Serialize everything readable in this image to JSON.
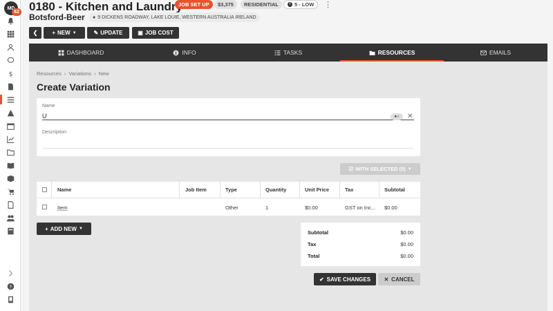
{
  "sidebar": {
    "avatar_initials": "MD",
    "notification_count": "82",
    "icons": [
      "bell-icon",
      "grid-icon",
      "user-icon",
      "chat-icon",
      "dollar-icon",
      "document-icon",
      "list-icon",
      "warning-icon",
      "calendar-icon",
      "chart-icon",
      "folder-icon",
      "book-icon",
      "box-icon",
      "cart-icon",
      "file-icon",
      "users-icon",
      "ledger-icon"
    ],
    "bottom_icons": [
      "chevron-right-icon",
      "help-icon",
      "tablet-icon"
    ]
  },
  "header": {
    "job_title": "0180 - Kitchen and Laundry",
    "status_badge": "JOB SET UP",
    "amount_badge": "$3,375",
    "type_badge": "RESIDENTIAL",
    "priority_badge": "5 - LOW",
    "client_name": "Botsford-Beer",
    "address": "9 DICKENS ROADWAY, LAKE LOUIE, WESTERN AUSTRALIA IRELAND"
  },
  "toolbar": {
    "new_label": "NEW",
    "update_label": "UPDATE",
    "job_cost_label": "JOB COST"
  },
  "tabs": [
    {
      "label": "DASHBOARD",
      "icon": "grid-icon"
    },
    {
      "label": "INFO",
      "icon": "info-icon"
    },
    {
      "label": "TASKS",
      "icon": "tasks-icon"
    },
    {
      "label": "RESOURCES",
      "icon": "folder-icon",
      "active": true
    },
    {
      "label": "EMAILS",
      "icon": "mail-icon"
    }
  ],
  "breadcrumb": [
    "Resources",
    "Variations",
    "New"
  ],
  "page_title": "Create Variation",
  "form": {
    "name_label": "Name",
    "name_value": "U",
    "description_label": "Description"
  },
  "with_selected_label": "WITH SELECTED (0)",
  "table": {
    "columns": [
      "Name",
      "Job Item",
      "Type",
      "Quantity",
      "Unit Price",
      "Tax",
      "Subtotal"
    ],
    "rows": [
      {
        "name": "Item",
        "job_item": "",
        "type": "Other",
        "quantity": "1",
        "unit_price": "$0.00",
        "tax": "GST on Inc...",
        "subtotal": "$0.00"
      }
    ]
  },
  "add_new_label": "ADD NEW",
  "totals": {
    "subtotal_label": "Subtotal",
    "subtotal_value": "$0.00",
    "tax_label": "Tax",
    "tax_value": "$0.00",
    "total_label": "Total",
    "total_value": "$0.00"
  },
  "actions": {
    "save_label": "SAVE CHANGES",
    "cancel_label": "CANCEL"
  },
  "colors": {
    "accent": "#e8522d",
    "dark": "#333333"
  }
}
